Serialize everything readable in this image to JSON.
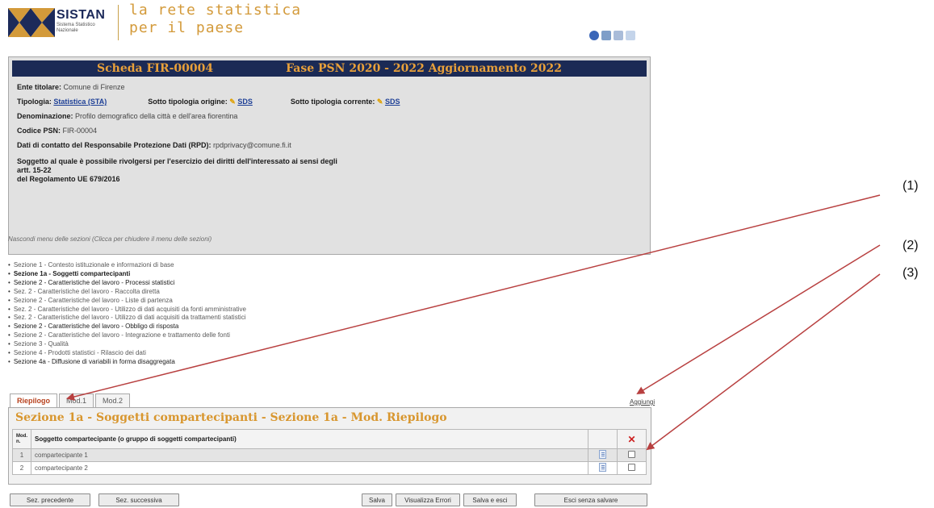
{
  "header": {
    "logo_title": "SISTAN",
    "logo_subtitle": "Sistema Statistico Nazionale",
    "tagline_line1": "la rete statistica",
    "tagline_line2": "per il paese"
  },
  "scheda": {
    "title_left": "Scheda FIR-00004",
    "title_right": "Fase PSN 2020 - 2022 Aggiornamento 2022",
    "ente_label": "Ente titolare:",
    "ente_value": "Comune di Firenze",
    "tipologia_label": "Tipologia:",
    "tipologia_value": "Statistica (STA)",
    "sotto_origine_label": "Sotto tipologia origine:",
    "sotto_origine_value": "SDS",
    "sotto_corrente_label": "Sotto tipologia corrente:",
    "sotto_corrente_value": "SDS",
    "denominazione_label": "Denominazione:",
    "denominazione_value": "Profilo demografico della città e dell'area fiorentina",
    "codice_label": "Codice PSN:",
    "codice_value": "FIR-00004",
    "rpd_label": "Dati di contatto del Responsabile Protezione Dati (RPD):",
    "rpd_value": "rpdprivacy@comune.fi.it",
    "soggetto_line1": "Soggetto al quale è possibile rivolgersi per l'esercizio dei diritti dell'interessato ai sensi degli",
    "soggetto_line2": "artt. 15-22",
    "soggetto_line3": "del Regolamento UE 679/2016"
  },
  "menu": {
    "hide_text": "Nascondi menu delle sezioni (Clicca per chiudere il menu delle sezioni)",
    "sections": [
      "Sezione 1 - Contesto istituzionale e informazioni di base",
      "Sezione 1a - Soggetti compartecipanti",
      "Sezione 2 - Caratteristiche del lavoro - Processi statistici",
      "Sez. 2 - Caratteristiche del lavoro - Raccolta diretta",
      "Sezione 2 - Caratteristiche del lavoro - Liste di partenza",
      "Sez. 2 - Caratteristiche del lavoro - Utilizzo di dati acquisiti da fonti amministrative",
      "Sez. 2 - Caratteristiche del lavoro - Utilizzo di dati acquisiti da trattamenti statistici",
      "Sezione 2 - Caratteristiche del lavoro - Obbligo di risposta",
      "Sezione 2 - Caratteristiche del lavoro - Integrazione e trattamento delle fonti",
      "Sezione 3 - Qualità",
      "Sezione 4 - Prodotti statistici - Rilascio dei dati",
      "Sezione 4a - Diffusione di variabili in forma disaggregata"
    ]
  },
  "tabs": [
    "Riepilogo",
    "Mod.1",
    "Mod.2"
  ],
  "aggiungi": "Aggiungi",
  "section_box": {
    "title": "Sezione 1a - Soggetti compartecipanti - Sezione 1a - Mod. Riepilogo",
    "col_mod": "Mod. n.",
    "col_soggetto": "Soggetto compartecipante (o gruppo di soggetti compartecipanti)",
    "del_header": "✕",
    "rows": [
      {
        "n": "1",
        "name": "compartecipante 1"
      },
      {
        "n": "2",
        "name": "compartecipante 2"
      }
    ]
  },
  "buttons": {
    "prev": "Sez. precedente",
    "next": "Sez. successiva",
    "salva": "Salva",
    "errori": "Visualizza Errori",
    "salva_esci": "Salva e esci",
    "esci": "Esci senza salvare"
  },
  "annotations": [
    "(1)",
    "(2)",
    "(3)"
  ],
  "colors": {
    "header_bar": "#1b2a55",
    "title_orange": "#e8a03a",
    "arrow_red": "#b84040",
    "link_blue": "#1d3f96"
  }
}
